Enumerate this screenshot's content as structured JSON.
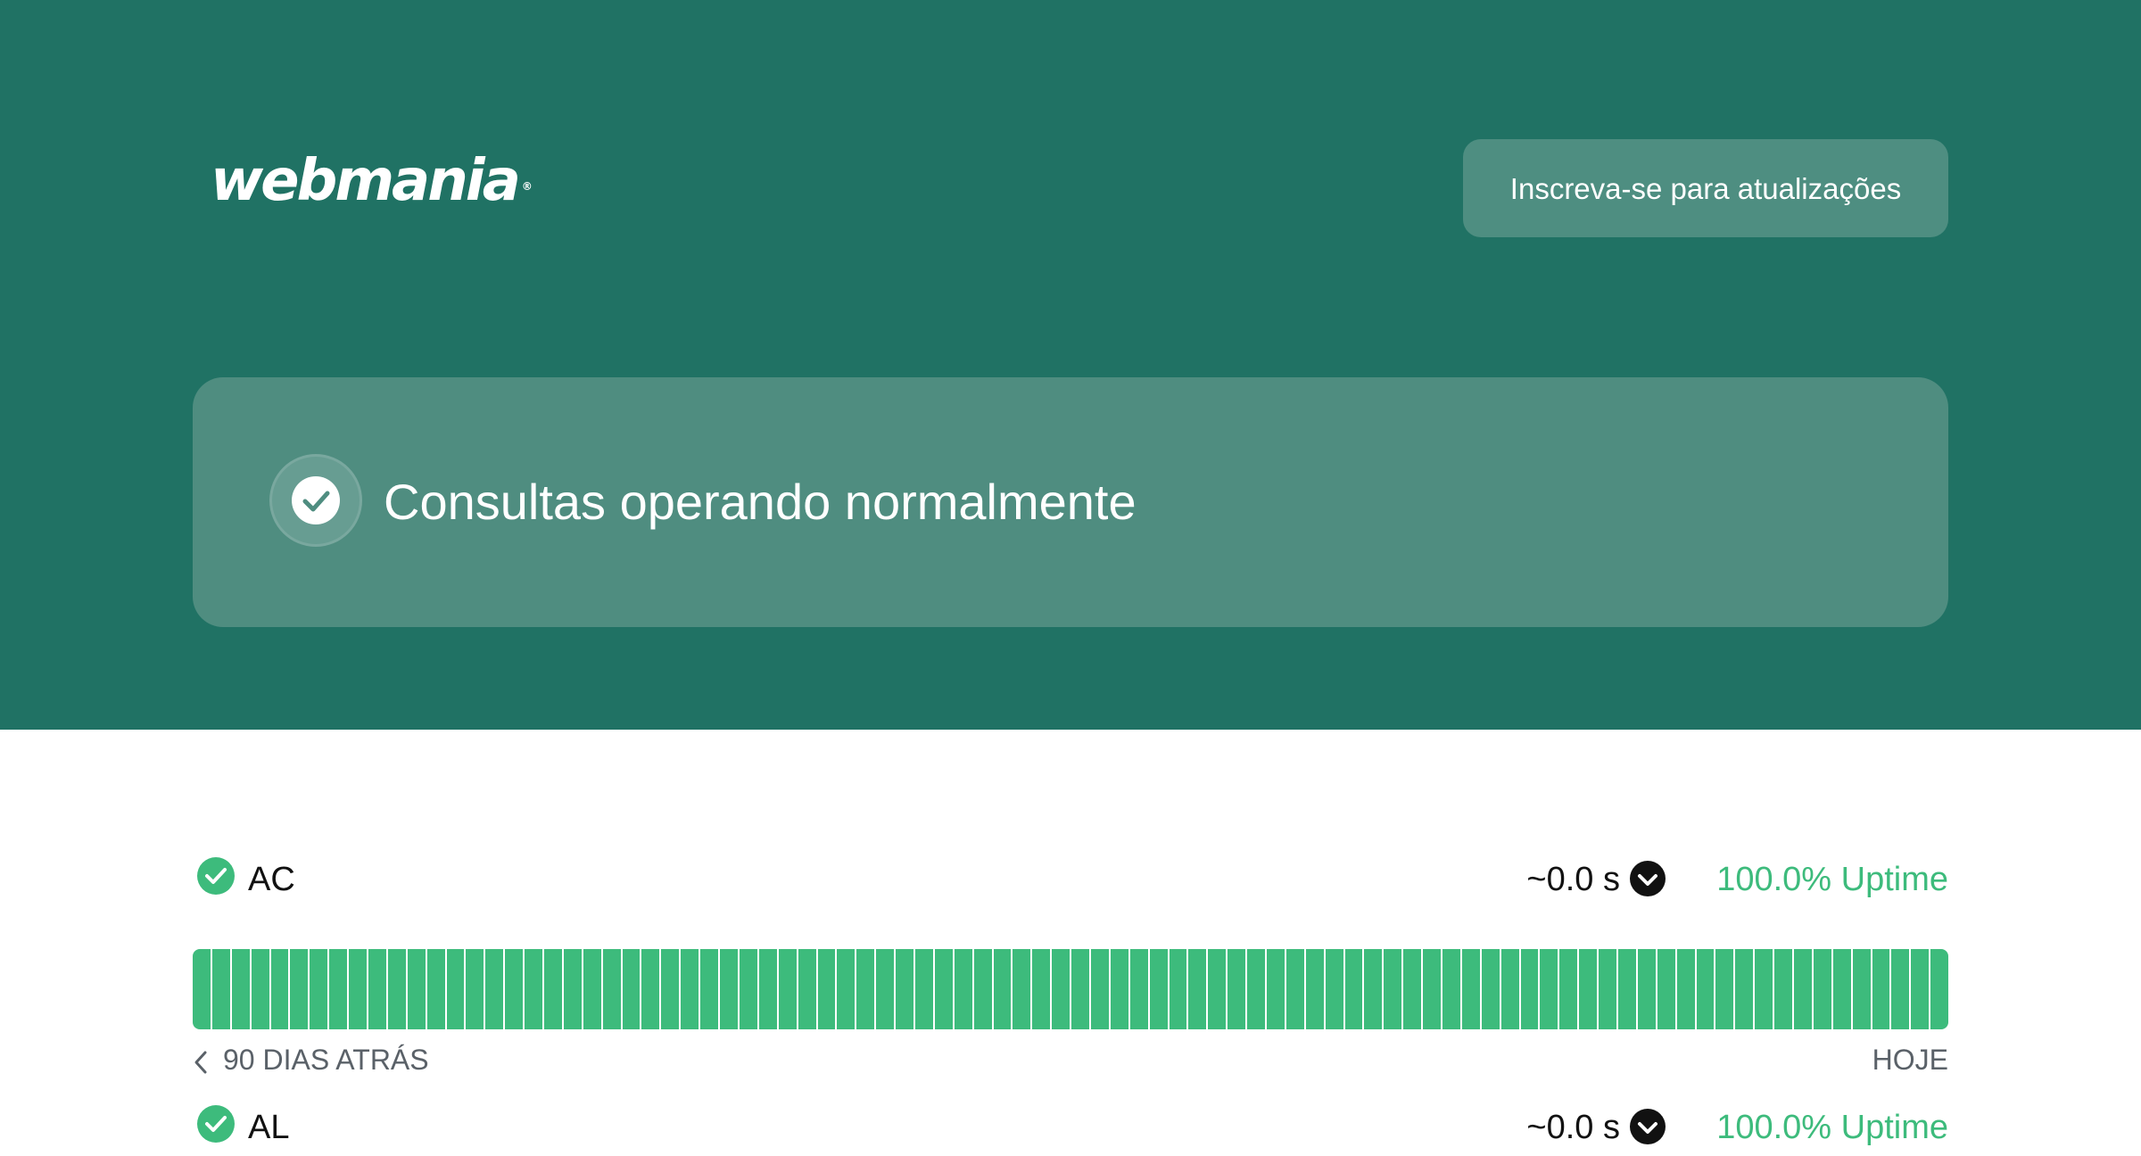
{
  "brand": {
    "logo_text": "webmania",
    "logo_mark": "®"
  },
  "header": {
    "subscribe_label": "Inscreva-se para atualizações"
  },
  "status": {
    "message": "Consultas operando normalmente",
    "icon": "check-circle-icon"
  },
  "colors": {
    "header_bg": "#207264",
    "card_bg": "#4f8d80",
    "button_bg": "#4e8e81",
    "operational_green": "#3dbb7c"
  },
  "components": [
    {
      "name": "AC",
      "response_time": "~0.0 s",
      "uptime": "100.0% Uptime",
      "days": 90,
      "range_start_label": "90 DIAS ATRÁS",
      "range_end_label": "HOJE"
    },
    {
      "name": "AL",
      "response_time": "~0.0 s",
      "uptime": "100.0% Uptime"
    }
  ]
}
